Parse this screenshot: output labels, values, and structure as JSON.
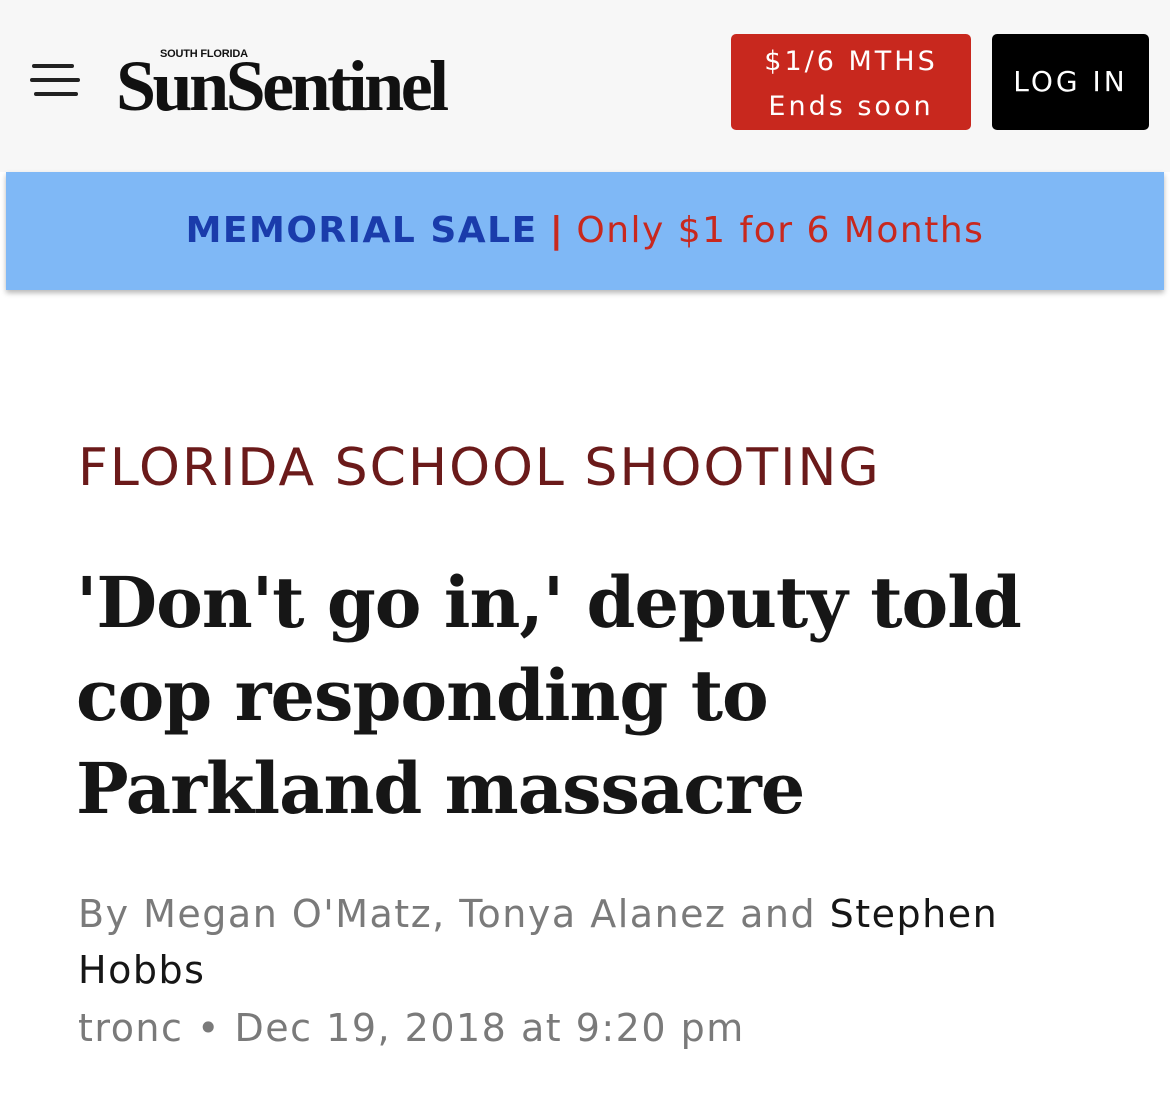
{
  "header": {
    "brand_small": "SOUTH FLORIDA",
    "brand_name": "SunSentinel",
    "subscribe_line1": "$1/6 MTHS",
    "subscribe_line2": "Ends soon",
    "login_label": "LOG IN",
    "menu_icon": "hamburger-menu-icon"
  },
  "promo": {
    "sale_label": "MEMORIAL SALE",
    "separator": "|",
    "offer_text": "Only $1 for 6 Months"
  },
  "article": {
    "section": "FLORIDA SCHOOL SHOOTING",
    "headline": "'Don't go in,' deputy told cop responding to Parkland massacre",
    "byline_prefix": "By Megan O'Matz, Tonya Alanez and ",
    "byline_linked_author": "Stephen Hobbs",
    "source": "tronc",
    "bullet": "•",
    "date": "Dec 19, 2018 at 9:20 pm"
  },
  "colors": {
    "header_bg": "#f7f7f7",
    "subscribe_red": "#c8281e",
    "login_black": "#000000",
    "promo_blue": "#7fb8f6",
    "promo_sale_text": "#1a3cab",
    "section_label": "#6b1a1a",
    "headline_text": "#161616",
    "meta_gray": "#7a7a7a"
  }
}
